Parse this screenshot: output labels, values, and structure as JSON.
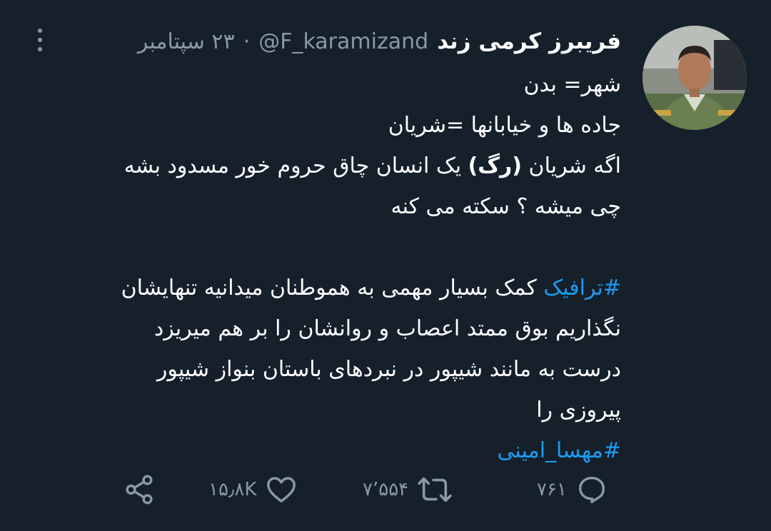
{
  "tweet": {
    "author": {
      "display_name": "فریبرز کرمی زند",
      "handle": "@F_karamizand",
      "avatar_icon": "profile-photo"
    },
    "separator": "·",
    "date": "۲۳ سپتامبر",
    "more_icon": "more-vertical-icon",
    "body": {
      "line1": "شهر= بدن",
      "line2": "جاده ها و خیابانها =شریان",
      "line3_start": "اگه شریان ",
      "line3_bold": "(رگ)",
      "line3_end": " یک انسان چاق حروم خور مسدود بشه",
      "line4": "چی میشه ؟ سکته می کنه",
      "hashtag1": "#ترافیک",
      "line5_rest": " کمک بسیار مهمی به هموطنان میدانیه تنهایشان",
      "line6": "نگذاریم بوق ممتد اعصاب و روانشان را بر هم میریزد",
      "line7": "درست به مانند شیپور در نبردهای باستان بنواز شیپور",
      "line8": "پیروزی را",
      "hashtag2": "#مهسا_امینی"
    },
    "actions": {
      "reply": {
        "icon": "reply-icon",
        "count": "۷۶۱"
      },
      "retweet": {
        "icon": "retweet-icon",
        "count": "۷٬۵۵۴"
      },
      "like": {
        "icon": "heart-icon",
        "count": "۱۵٫۸K"
      },
      "share": {
        "icon": "share-icon"
      }
    },
    "colors": {
      "background": "#15202b",
      "text": "#ffffff",
      "muted": "#8b98a5",
      "link": "#1d9bf0"
    }
  }
}
